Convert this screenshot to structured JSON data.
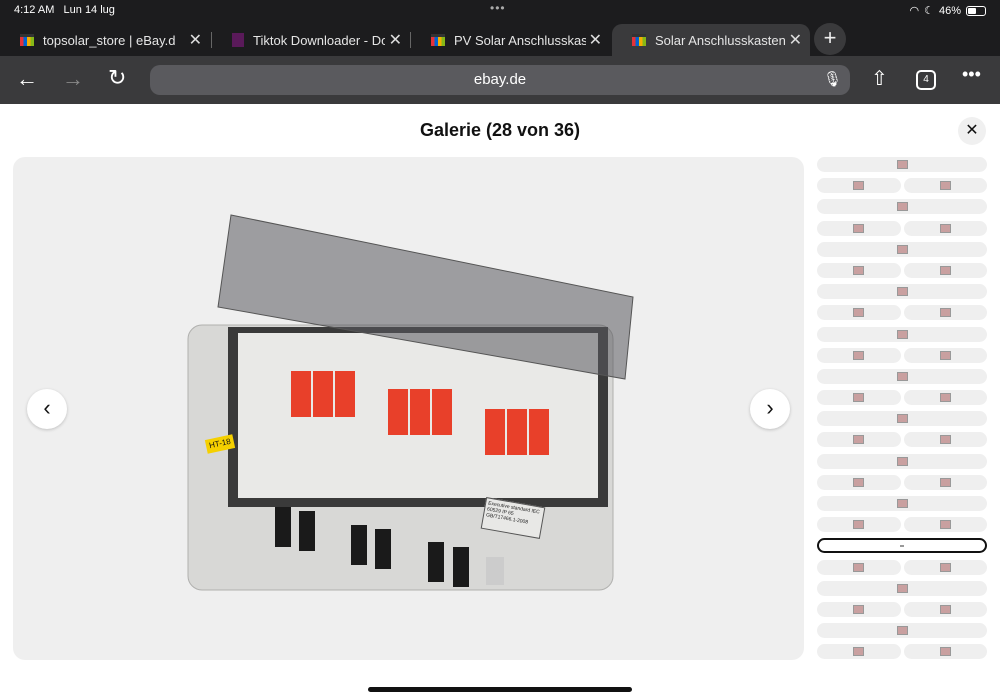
{
  "status": {
    "time": "4:12 AM",
    "date": "Lun 14 lug",
    "battery": "46%",
    "battery_level": 0.46
  },
  "tabs": [
    {
      "title": "topsolar_store | eBay.de",
      "active": false
    },
    {
      "title": "Tiktok Downloader - Download",
      "active": false
    },
    {
      "title": "PV Solar Anschlusskasten",
      "active": false
    },
    {
      "title": "Solar Anschlusskasten Unterverteilung",
      "active": true
    }
  ],
  "toolbar": {
    "url": "ebay.de",
    "tab_count": "4"
  },
  "gallery": {
    "title": "Galerie (28 von 36)",
    "current": 28,
    "total": 36,
    "label_tag": "HT-18",
    "label_plate": "Executive standard IEC 60529 IP 65 GB/T17466.1-2008"
  },
  "colors": {
    "chrome_dark": "#1c1c1e",
    "toolbar": "#3a3a3c",
    "surge_protector": "#e8402a"
  }
}
